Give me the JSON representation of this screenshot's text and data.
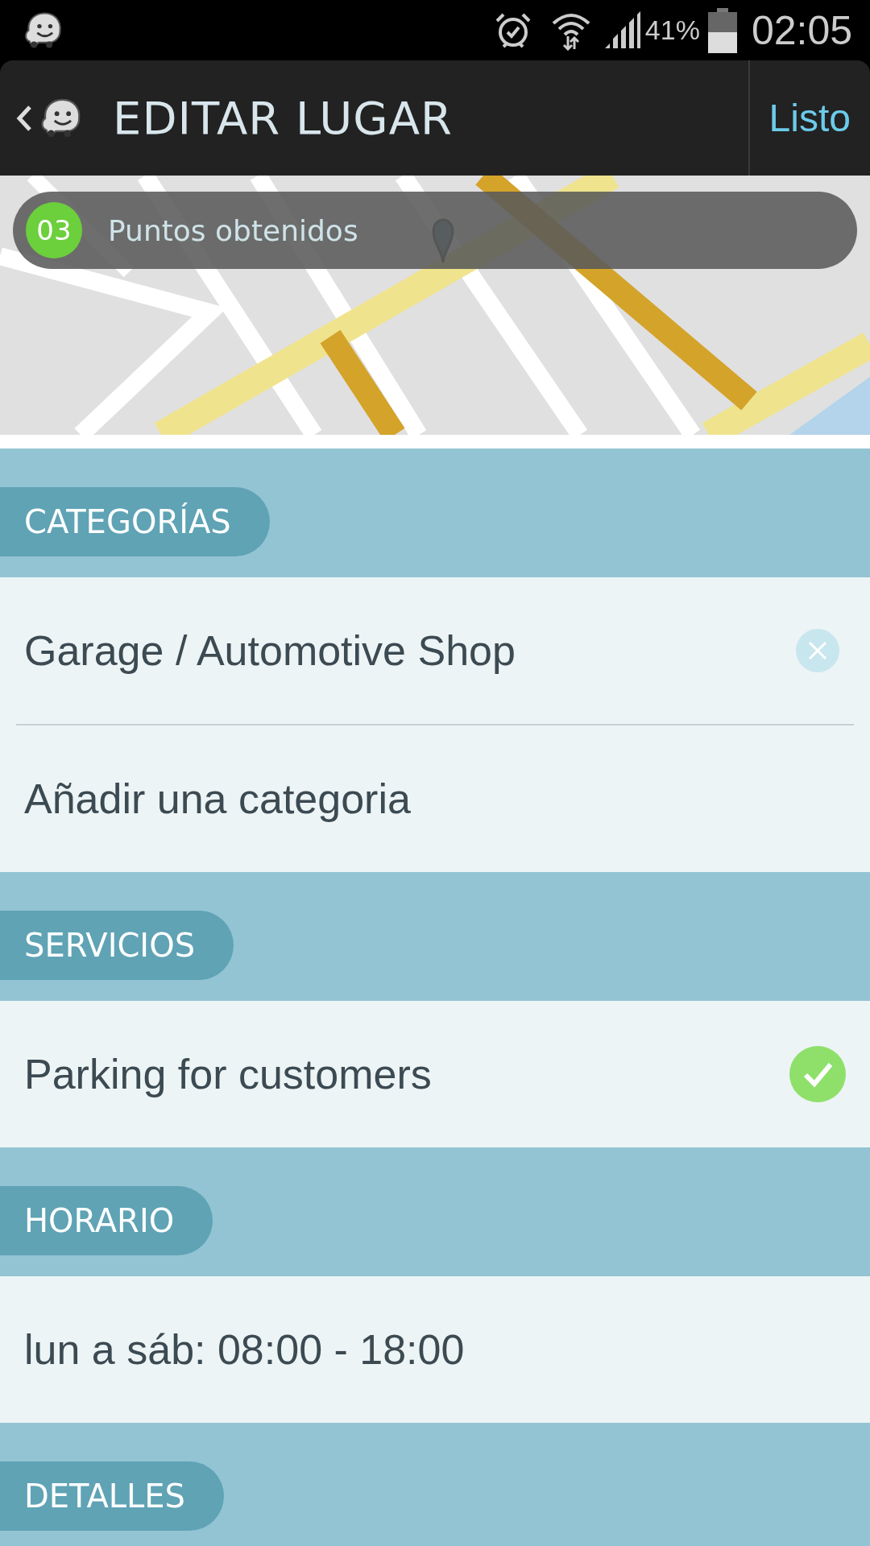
{
  "status_bar": {
    "battery_text": "41%",
    "time": "02:05"
  },
  "header": {
    "title": "EDITAR LUGAR",
    "action": "Listo"
  },
  "points": {
    "count": "03",
    "label": "Puntos obtenidos"
  },
  "sections": [
    {
      "title": "CATEGORÍAS",
      "rows": [
        {
          "text": "Garage / Automotive Shop",
          "kind": "removable"
        },
        {
          "text": "Añadir una categoria",
          "kind": "plain"
        }
      ]
    },
    {
      "title": "SERVICIOS",
      "rows": [
        {
          "text": "Parking for customers",
          "kind": "toggle",
          "checked": true
        }
      ]
    },
    {
      "title": "HORARIO",
      "rows": [
        {
          "text": "lun a sáb: 08:00 - 18:00",
          "kind": "plain"
        }
      ]
    },
    {
      "title": "DETALLES"
    }
  ]
}
